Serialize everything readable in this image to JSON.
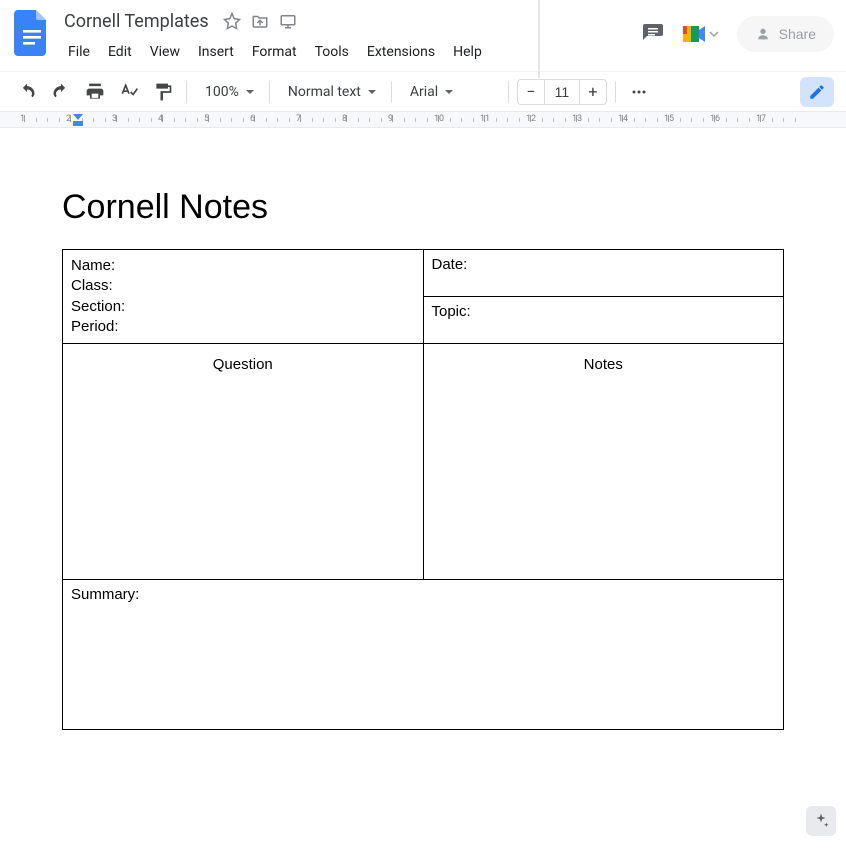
{
  "header": {
    "doc_title": "Cornell Templates",
    "menus": [
      "File",
      "Edit",
      "View",
      "Insert",
      "Format",
      "Tools",
      "Extensions",
      "Help"
    ],
    "share_label": "Share"
  },
  "toolbar": {
    "zoom": "100%",
    "style": "Normal text",
    "font": "Arial",
    "font_size": "11"
  },
  "ruler": {
    "units": [
      1,
      2,
      3,
      4,
      5,
      6,
      7,
      8,
      9,
      10,
      11,
      12,
      13,
      14,
      15,
      16,
      17
    ]
  },
  "document": {
    "title": "Cornell Notes",
    "info_left": [
      "Name:",
      "Class:",
      "Section:",
      "Period:"
    ],
    "info_date": "Date:",
    "info_topic": "Topic:",
    "question_header": "Question",
    "notes_header": "Notes",
    "summary_label": "Summary:"
  }
}
